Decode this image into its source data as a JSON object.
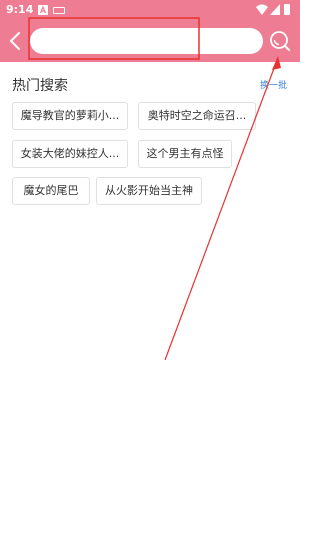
{
  "status_bar": {
    "time": "9:14",
    "icons": [
      "notification-a-icon",
      "keyboard-icon",
      "wifi-icon",
      "signal-icon",
      "battery-icon"
    ]
  },
  "toolbar": {
    "back_icon": "chevron-left-icon",
    "search_placeholder": "",
    "search_value": "",
    "search_icon": "search-icon"
  },
  "hot_search": {
    "title": "热门搜索",
    "refresh_label": "换一批",
    "tags": [
      {
        "label": "魔导教官的萝莉小..."
      },
      {
        "label": "奥特时空之命运召..."
      },
      {
        "label": "女装大佬的妹控人..."
      },
      {
        "label": "这个男主有点怪"
      },
      {
        "label": "魔女的尾巴"
      },
      {
        "label": "从火影开始当主神"
      }
    ]
  },
  "annotation": {
    "color": "#e8322f",
    "shapes": [
      "highlight-box",
      "arrow"
    ]
  },
  "colors": {
    "header": "#ee7d94",
    "link": "#3a82d8"
  }
}
